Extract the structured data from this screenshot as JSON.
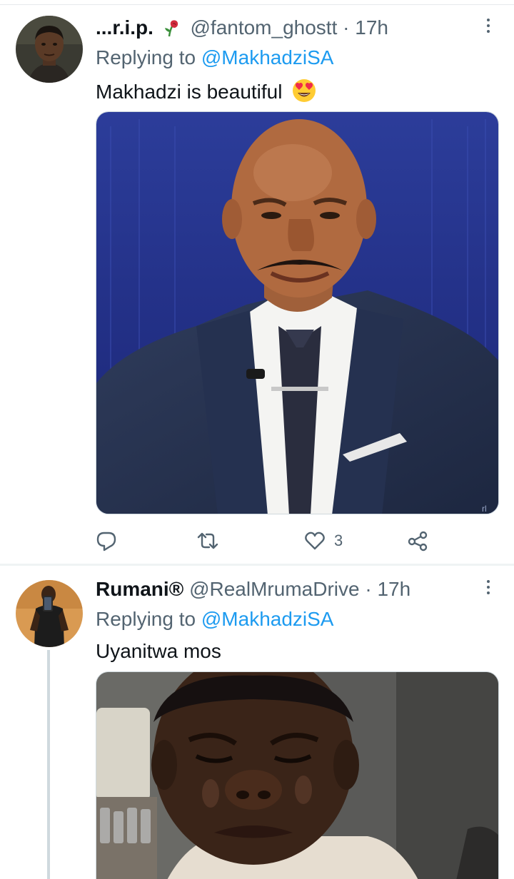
{
  "tweets": [
    {
      "display_name": "...r.i.p.",
      "handle": "@fantom_ghostt",
      "separator": "·",
      "time": "17h",
      "reply_prefix": "Replying to",
      "reply_to": "@MakhadziSA",
      "text": "Makhadzi is beautiful",
      "emoji": "smiling-face-with-heart-eyes",
      "flair_icon": "wilted-rose-icon",
      "actions": {
        "reply_count": "",
        "retweet_count": "",
        "like_count": "3"
      }
    },
    {
      "display_name": "Rumani®",
      "handle": "@RealMrumaDrive",
      "separator": "·",
      "time": "17h",
      "reply_prefix": "Replying to",
      "reply_to": "@MakhadziSA",
      "text": "Uyanitwa mos"
    }
  ],
  "colors": {
    "link": "#1d9bf0",
    "secondary_text": "#536471",
    "primary_text": "#0f1419",
    "divider": "#eff3f4"
  }
}
